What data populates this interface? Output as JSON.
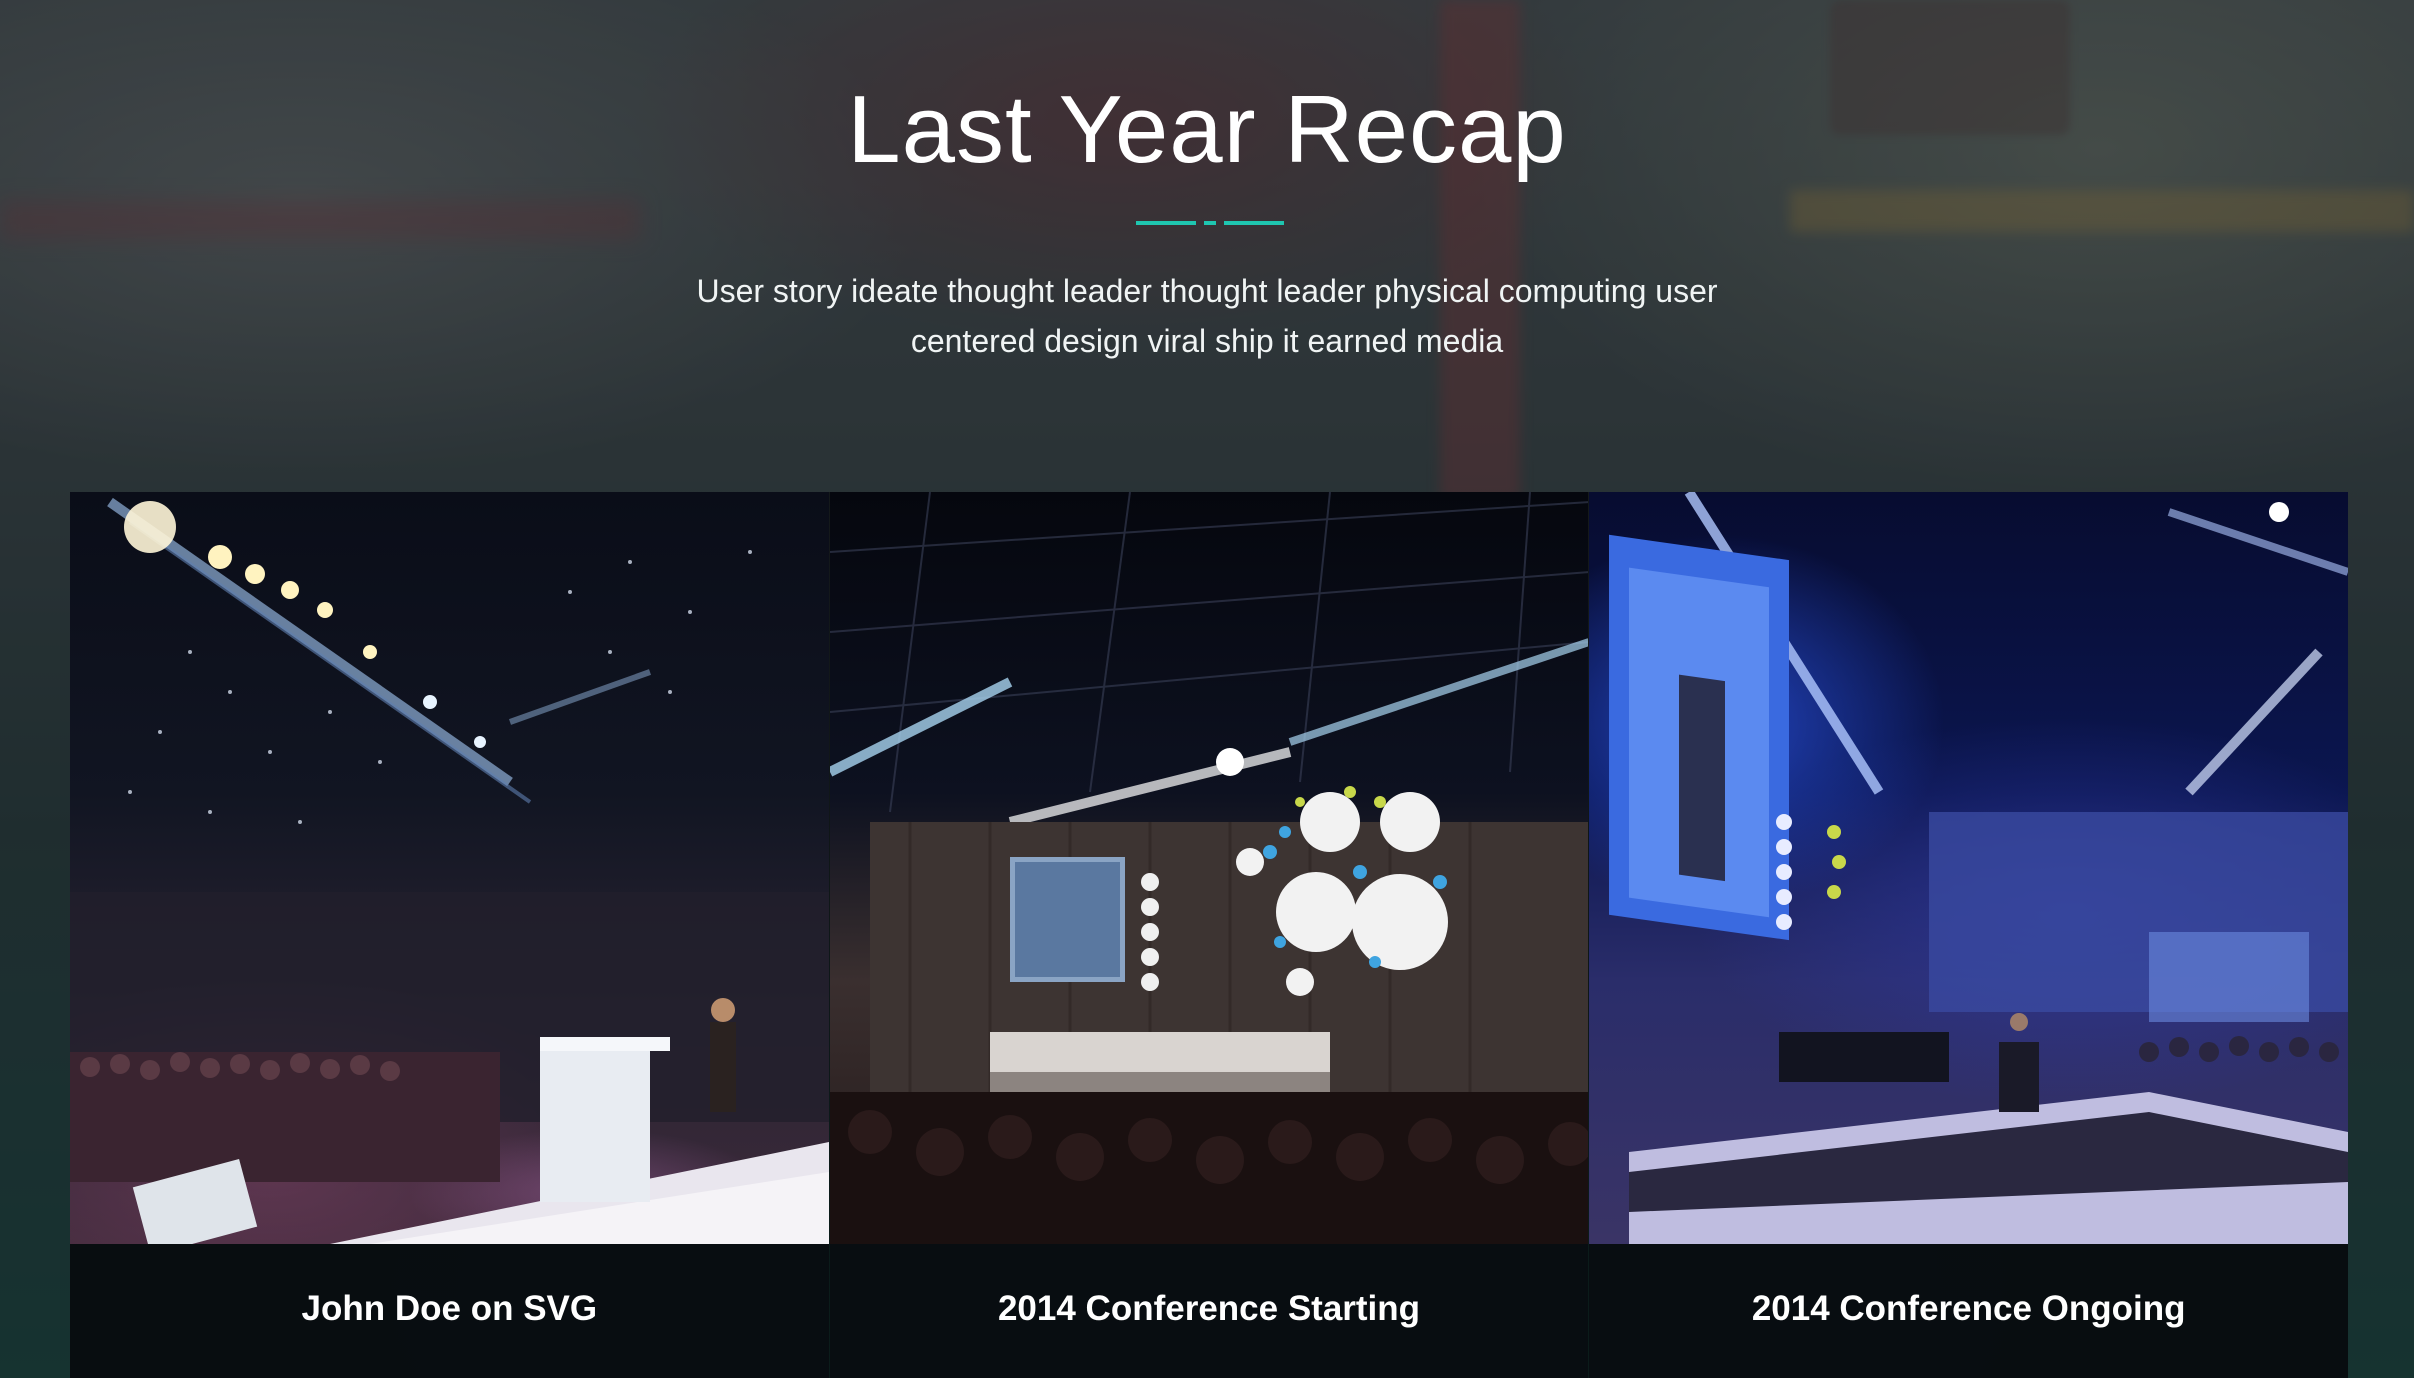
{
  "section": {
    "title": "Last Year Recap",
    "subtitle": "User story ideate thought leader thought leader physical computing user centered design viral ship it earned media"
  },
  "colors": {
    "accent": "#1fc6b0",
    "caption_bg": "#0a0c10",
    "text": "#ffffff"
  },
  "gallery": {
    "items": [
      {
        "caption": "John Doe on SVG",
        "image": "speaker-on-stage-photo"
      },
      {
        "caption": "2014 Conference Starting",
        "image": "conference-hall-panel-photo"
      },
      {
        "caption": "2014 Conference Ongoing",
        "image": "conference-hall-blue-stage-photo"
      }
    ]
  }
}
